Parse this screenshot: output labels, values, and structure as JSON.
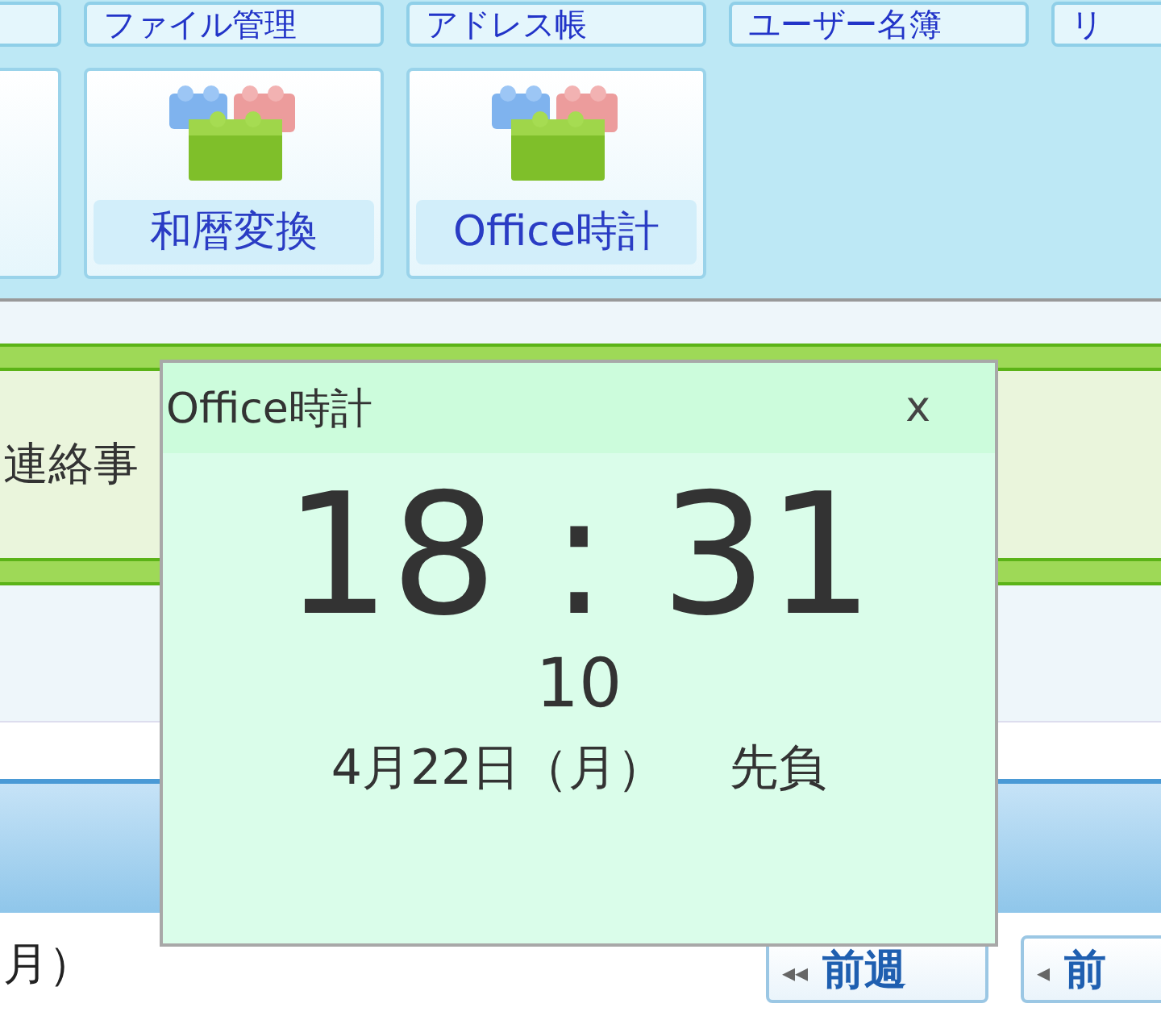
{
  "top_row": [
    {
      "label": "ファイル管理"
    },
    {
      "label": "アドレス帳"
    },
    {
      "label": "ユーザー名簿"
    },
    {
      "label": "リ"
    }
  ],
  "app_buttons": [
    {
      "label": "和暦変換"
    },
    {
      "label": "Office時計"
    }
  ],
  "notice": {
    "text": "連絡事"
  },
  "date_heading": "月）",
  "nav_buttons": [
    {
      "arrow": "◂◂",
      "label": "前週"
    },
    {
      "arrow": "◂",
      "label": "前"
    }
  ],
  "clock_popup": {
    "title": "Office時計",
    "close": "x",
    "time": "18 : 31",
    "seconds": "10",
    "date": "4月22日（月）",
    "rokuyo": "先負"
  }
}
